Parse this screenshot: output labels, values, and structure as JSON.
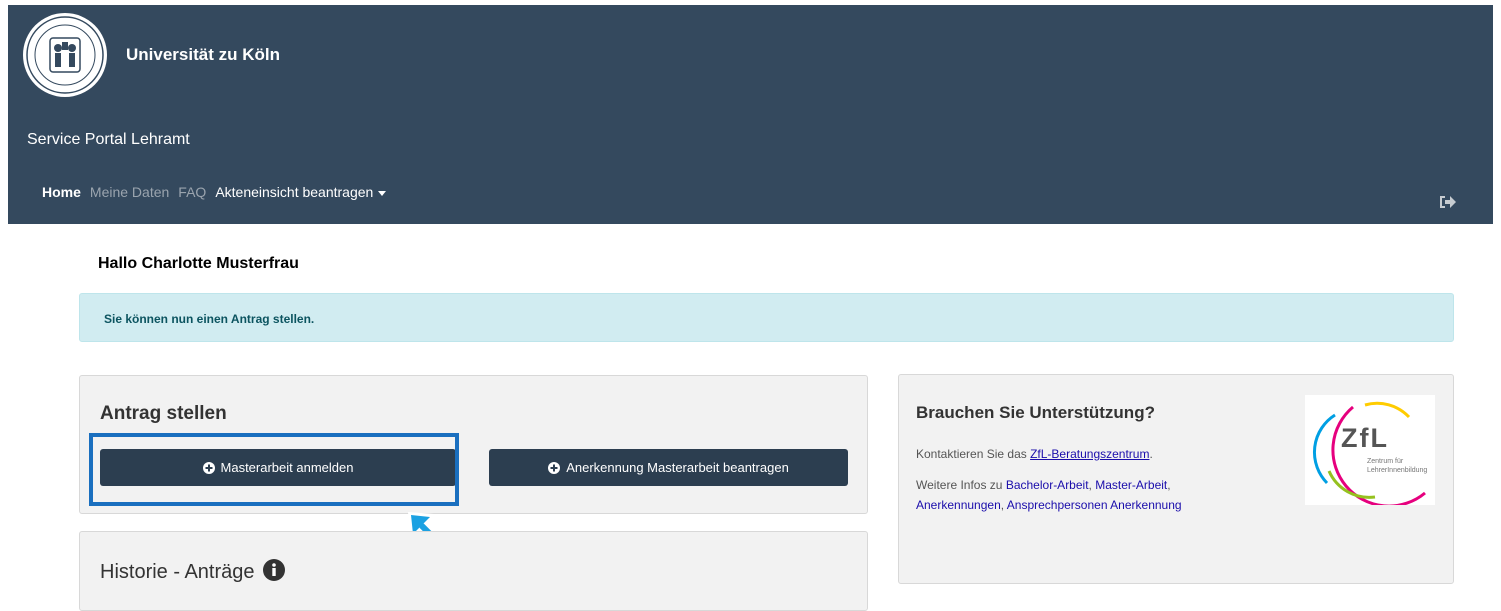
{
  "header": {
    "university": "Universität zu Köln",
    "portal_title": "Service Portal Lehramt"
  },
  "nav": {
    "items": [
      {
        "label": "Home",
        "state": "active"
      },
      {
        "label": "Meine Daten",
        "state": "inactive"
      },
      {
        "label": "FAQ",
        "state": "inactive"
      },
      {
        "label": "Akteneinsicht beantragen",
        "state": "dropdown"
      }
    ],
    "logout_icon": "sign-out-icon"
  },
  "greeting": "Hallo Charlotte Musterfrau",
  "alert": {
    "text": "Sie können nun einen Antrag stellen."
  },
  "antrag": {
    "title": "Antrag stellen",
    "btn_master": "Masterarbeit anmelden",
    "btn_anerkennung": "Anerkennung Masterarbeit beantragen",
    "button_icon": "plus-circle-icon"
  },
  "historie": {
    "title": "Historie - Anträge",
    "info_icon": "info-circle-icon"
  },
  "support": {
    "title": "Brauchen Sie Unterstützung?",
    "contact_prefix": "Kontaktieren Sie das ",
    "contact_link": "ZfL-Beratungszentrum",
    "contact_suffix": ".",
    "infos_prefix": "Weitere Infos zu ",
    "link_bachelor": "Bachelor-Arbeit",
    "sep1": ", ",
    "link_master": "Master-Arbeit",
    "sep2": ", ",
    "link_anerkennungen": "Anerkennungen",
    "sep3": ", ",
    "link_ansprech": "Ansprechpersonen Anerkennung"
  },
  "zfl_logo": {
    "big": "ZfL",
    "line1": "Zentrum für",
    "line2": "LehrerInnenbildung"
  },
  "colors": {
    "header_bg": "#34495e",
    "button_bg": "#2c3e50",
    "alert_bg": "#d1ecf1",
    "highlight": "#1a6fbf",
    "arrow": "#1ba1e2"
  }
}
